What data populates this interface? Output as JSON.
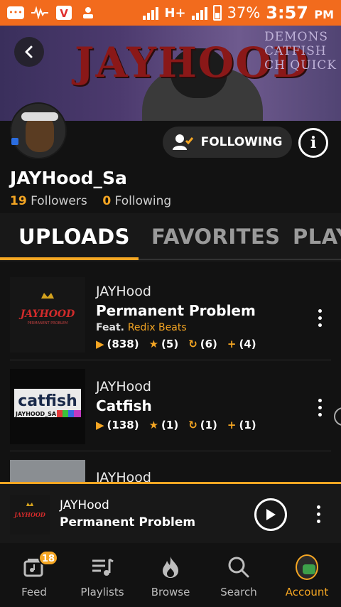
{
  "status_bar": {
    "network": "H+",
    "battery": "37%",
    "time": "3:57",
    "ampm": "PM"
  },
  "banner": {
    "art_text": "JAYHOOD",
    "side_text": [
      "DEMONS",
      "CATFISH",
      "CH QUICK"
    ]
  },
  "profile": {
    "follow_label": "FOLLOWING",
    "username": "JAYHood_Sa",
    "followers_count": "19",
    "followers_label": "Followers",
    "following_count": "0",
    "following_label": "Following"
  },
  "tabs": [
    {
      "label": "UPLOADS",
      "active": true
    },
    {
      "label": "FAVORITES",
      "active": false
    },
    {
      "label": "PLAY",
      "active": false
    }
  ],
  "uploads": [
    {
      "artist": "JAYHood",
      "title": "Permanent  Problem",
      "feat_prefix": "Feat.",
      "feat_name": "Redix Beats",
      "thumb_text": "JAYHOOD",
      "thumb_sub": "PERMANENT PROBLEM",
      "stats": {
        "plays": "(838)",
        "favorites": "(5)",
        "reposts": "(6)",
        "adds": "(4)"
      }
    },
    {
      "artist": "JAYHood",
      "title": "Catfish",
      "thumb_text": "catfish",
      "thumb_sub": "JAYHOOD_SA",
      "stats": {
        "plays": "(138)",
        "favorites": "(1)",
        "reposts": "(1)",
        "adds": "(1)"
      }
    },
    {
      "artist": "JAYHood"
    }
  ],
  "player": {
    "artist": "JAYHood",
    "title": "Permanent  Problem",
    "thumb_text": "JAYHOOD"
  },
  "bottom_nav": [
    {
      "label": "Feed",
      "icon": "feed-icon",
      "badge": "18"
    },
    {
      "label": "Playlists",
      "icon": "playlists-icon"
    },
    {
      "label": "Browse",
      "icon": "flame-icon"
    },
    {
      "label": "Search",
      "icon": "search-icon"
    },
    {
      "label": "Account",
      "icon": "account-avatar",
      "active": true
    }
  ],
  "colors": {
    "accent": "#f5a623",
    "status_bar": "#f26b1d",
    "background": "#121212"
  }
}
